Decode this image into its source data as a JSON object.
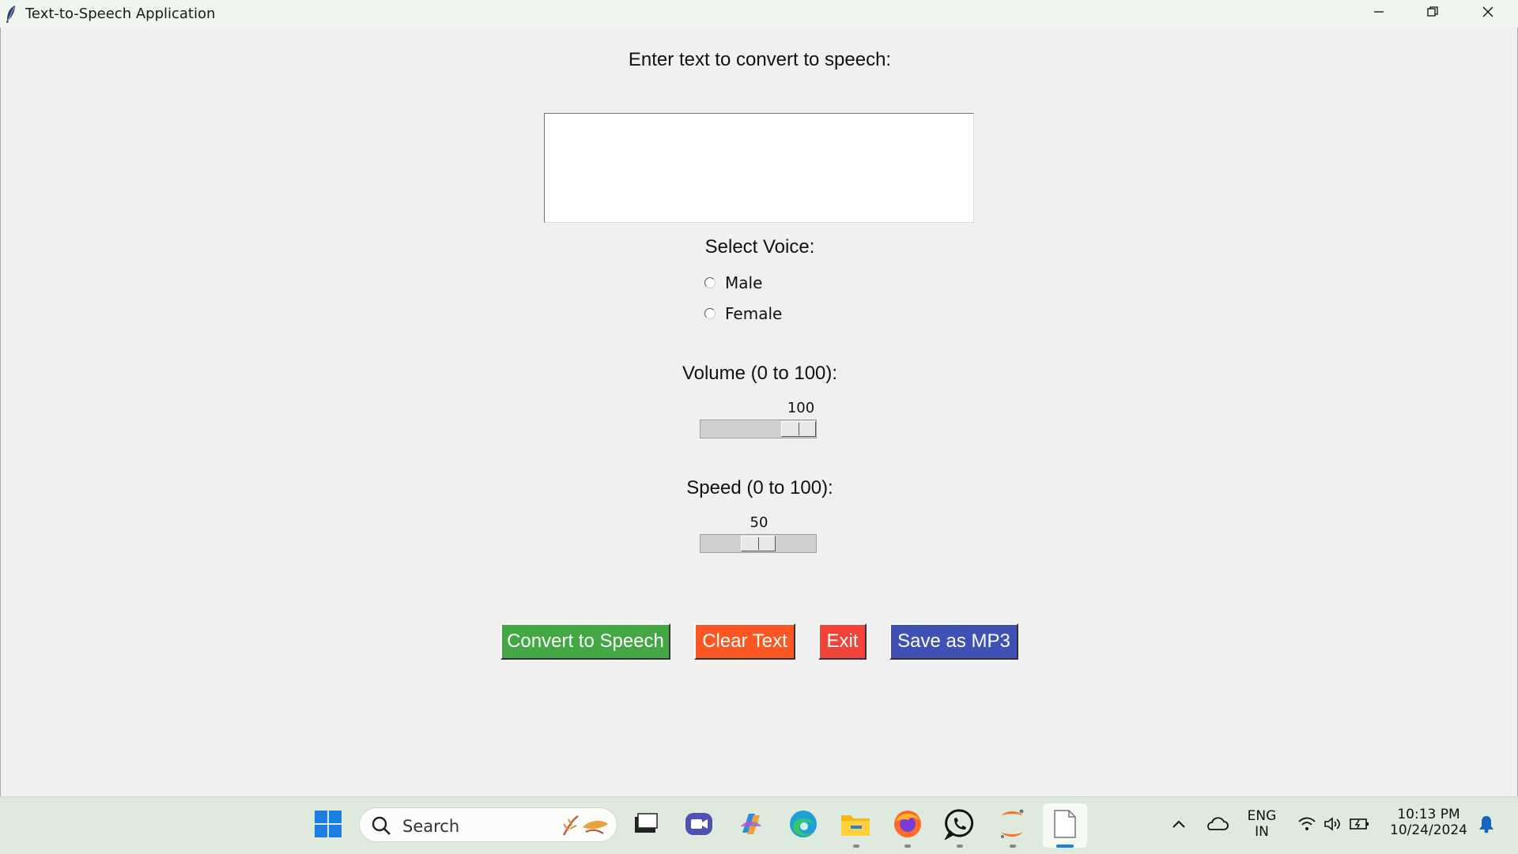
{
  "window": {
    "title": "Text-to-Speech Application"
  },
  "main": {
    "prompt_label": "Enter text to convert to speech:",
    "text_value": "",
    "voice": {
      "label": "Select Voice:",
      "options": [
        "Male",
        "Female"
      ],
      "selected": null
    },
    "volume": {
      "label": "Volume (0 to 100):",
      "value": "100",
      "level": 100
    },
    "speed": {
      "label": "Speed (0 to 100):",
      "value": "50",
      "level": 50
    },
    "buttons": {
      "convert": "Convert to Speech",
      "clear": "Clear Text",
      "exit": "Exit",
      "save": "Save as MP3"
    },
    "colors": {
      "convert": "#43a843",
      "clear": "#fc5722",
      "exit": "#f2423a",
      "save": "#3f51b5"
    }
  },
  "taskbar": {
    "search_placeholder": "Search",
    "language": {
      "line1": "ENG",
      "line2": "IN"
    },
    "time": "10:13 PM",
    "date": "10/24/2024"
  }
}
